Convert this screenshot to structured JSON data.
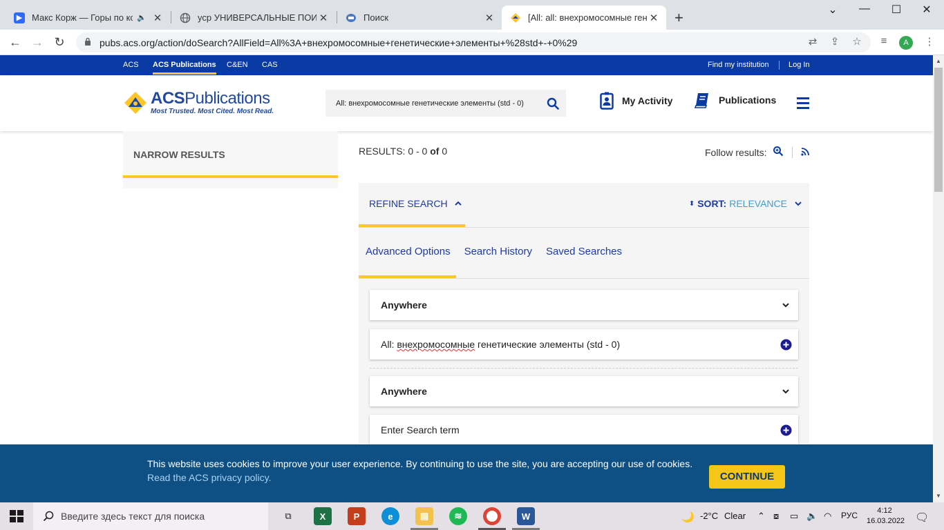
{
  "browser": {
    "tabs": [
      {
        "title": "Макс Корж — Горы по колено",
        "favicon_color": "#2d6bff",
        "audio": true
      },
      {
        "title": "уср УНИВЕРСАЛЬНЫЕ ПОИСКОВЫЕ",
        "favicon_color": "#5f6368"
      },
      {
        "title": "Поиск",
        "favicon_color": "#4a78c2"
      },
      {
        "title": "[All: all: внехромосомные генетические",
        "favicon_color": "#ffc629"
      }
    ],
    "new_tab": "+",
    "url": "pubs.acs.org/action/doSearch?AllField=All%3A+внехромосомные+генетические+элементы+%28std+-+0%29",
    "profile_initial": "A"
  },
  "acs_bar": {
    "left_links": [
      "ACS",
      "ACS Publications",
      "C&EN",
      "CAS"
    ],
    "find_institution": "Find my institution",
    "login": "Log In"
  },
  "header": {
    "logo_main_bold": "ACS",
    "logo_main": "Publications",
    "logo_tagline": "Most Trusted. Most Cited. Most Read.",
    "search_query": "All: внехромосомные генетические элементы (std - 0)",
    "my_activity": "My Activity",
    "publications": "Publications"
  },
  "sidebar": {
    "title": "NARROW RESULTS"
  },
  "results": {
    "label": "RESULTS:",
    "range": "0 - 0",
    "of": "of",
    "total": "0",
    "follow": "Follow results:"
  },
  "refine": {
    "tab": "REFINE SEARCH",
    "sort_label": "SORT:",
    "sort_value": "RELEVANCE",
    "subtabs": [
      "Advanced Options",
      "Search History",
      "Saved Searches"
    ],
    "field1": "Anywhere",
    "term1_prefix": "All:",
    "term1_underlined": "внехромосомные",
    "term1_rest": "генетические элементы (std - 0)",
    "field2": "Anywhere",
    "term2_placeholder": "Enter Search term"
  },
  "cookie": {
    "text": "This website uses cookies to improve your user experience. By continuing to use the site, you are accepting our use of cookies.",
    "link": "Read the ACS privacy policy.",
    "button": "CONTINUE"
  },
  "taskbar": {
    "search_placeholder": "Введите здесь текст для поиска",
    "weather_temp": "-2°C",
    "weather_text": "Clear",
    "lang": "РУС",
    "time": "4:12",
    "date": "16.03.2022"
  },
  "colors": {
    "acs_blue": "#0a3aa3",
    "accent_yellow": "#ffc629",
    "link_blue": "#1c3aa9",
    "cookie_bg": "#0e4f84"
  }
}
